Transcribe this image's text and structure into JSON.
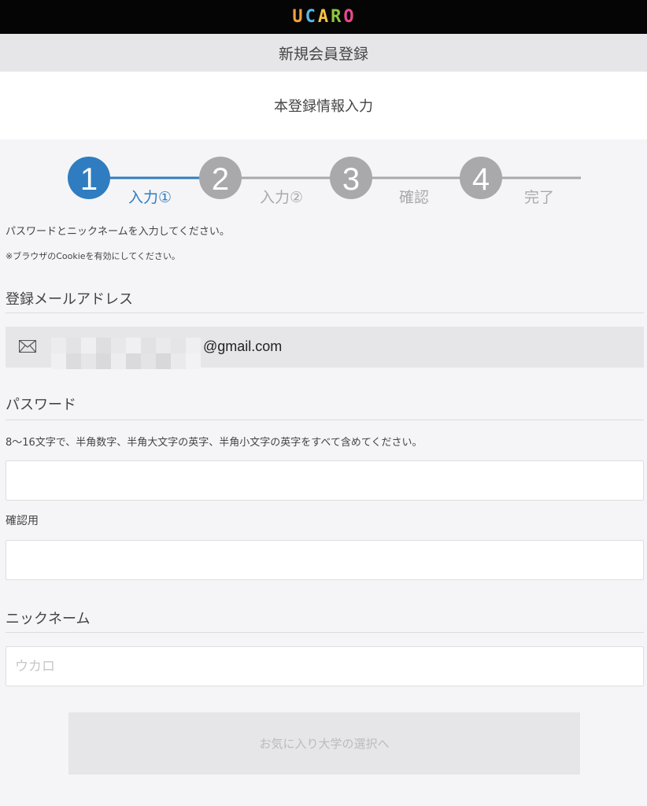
{
  "header": {
    "logo_letters": [
      "U",
      "C",
      "A",
      "R",
      "O"
    ],
    "logo_colors": [
      "#f0a23b",
      "#59b7e6",
      "#f5c542",
      "#8ec63f",
      "#e8498d"
    ]
  },
  "page_title": "新規会員登録",
  "subtitle": "本登録情報入力",
  "stepper": {
    "current_step": 1,
    "steps": [
      {
        "number": "1",
        "label": "入力①"
      },
      {
        "number": "2",
        "label": "入力②"
      },
      {
        "number": "3",
        "label": "確認"
      },
      {
        "number": "4",
        "label": "完了"
      }
    ],
    "active_color": "#2f7dc0",
    "inactive_color": "#a9a9ab"
  },
  "notes": {
    "instruction": "パスワードとニックネームを入力してください。",
    "cookie": "※ブラウザのCookieを有効にしてください。"
  },
  "email_section": {
    "title": "登録メールアドレス",
    "value_suffix": "@gmail.com",
    "icon": "mail-icon"
  },
  "password_section": {
    "title": "パスワード",
    "hint": "8～16文字で、半角数字、半角大文字の英字、半角小文字の英字をすべて含めてください。",
    "password_value": "",
    "confirm_label": "確認用",
    "confirm_value": ""
  },
  "nickname_section": {
    "title": "ニックネーム",
    "placeholder": "ウカロ",
    "value": ""
  },
  "submit_button": {
    "label": "お気に入り大学の選択へ",
    "disabled": true
  }
}
